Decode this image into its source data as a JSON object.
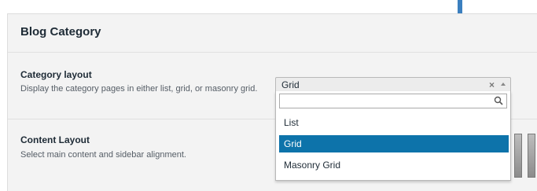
{
  "section": {
    "title": "Blog Category"
  },
  "category_layout": {
    "title": "Category layout",
    "description": "Display the category pages in either list, grid, or masonry grid.",
    "selected": "Grid",
    "clear_label": "×",
    "search": {
      "value": "",
      "placeholder": ""
    },
    "options": [
      "List",
      "Grid",
      "Masonry Grid"
    ],
    "selected_index": 1
  },
  "content_layout": {
    "title": "Content Layout",
    "description": "Select main content and sidebar alignment."
  },
  "colors": {
    "accent": "#0d73aa",
    "arrow": "#3b7fbf",
    "panel_bg": "#f3f3f3"
  },
  "icons": [
    "down-arrow-icon",
    "clear-icon",
    "caret-up-icon",
    "magnifier-icon"
  ]
}
